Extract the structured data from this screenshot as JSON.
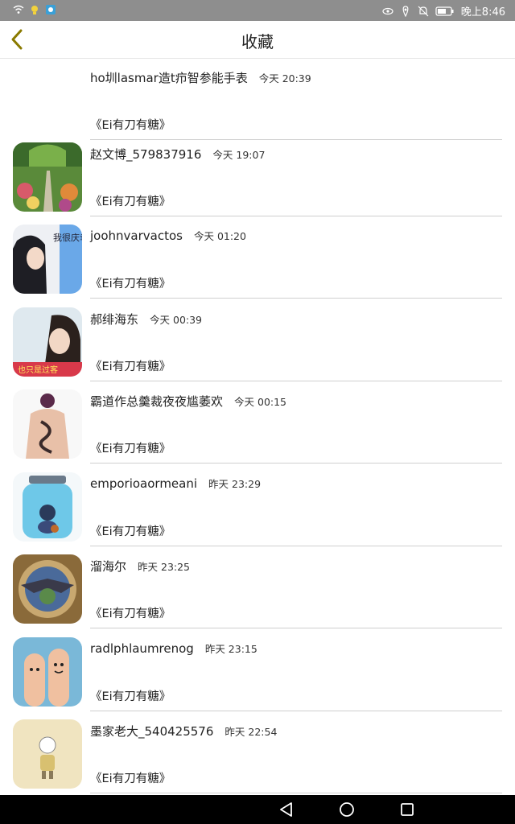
{
  "status_bar": {
    "time": "晚上8:46",
    "icons": [
      "wifi-icon",
      "bulb-icon",
      "app-icon",
      "eye-icon",
      "location-icon",
      "mute-icon",
      "battery-icon"
    ]
  },
  "header": {
    "title": "收藏",
    "back_icon": "chevron-left-icon"
  },
  "items": [
    {
      "name": "ho圳lasmar造t疖智参能手表",
      "time": "今天 20:39",
      "quote": "《Ei有刀有糖》",
      "avatar": "none"
    },
    {
      "name": "赵文博_579837916",
      "time": "今天 19:07",
      "quote": "《Ei有刀有糖》",
      "avatar": "garden"
    },
    {
      "name": "joohnvarvactos",
      "time": "今天 01:20",
      "quote": "《Ei有刀有糖》",
      "avatar": "girl-with-text",
      "avatar_text": "我很庆幸 我遇见你"
    },
    {
      "name": "郝绯海东",
      "time": "今天 00:39",
      "quote": "《Ei有刀有糖》",
      "avatar": "girl-sky",
      "avatar_text": "也只是过客"
    },
    {
      "name": "霸道作总羹裁夜夜尴萎欢",
      "time": "今天 00:15",
      "quote": "《Ei有刀有糖》",
      "avatar": "dragon-tattoo"
    },
    {
      "name": "emporioaormeani",
      "time": "昨天 23:29",
      "quote": "《Ei有刀有糖》",
      "avatar": "jar"
    },
    {
      "name": "溜海尔",
      "time": "昨天 23:25",
      "quote": "《Ei有刀有糖》",
      "avatar": "bat-emblem"
    },
    {
      "name": "radlphlaumrenog",
      "time": "昨天 23:15",
      "quote": "《Ei有刀有糖》",
      "avatar": "finger-faces"
    },
    {
      "name": "墨家老大_540425576",
      "time": "昨天 22:54",
      "quote": "《Ei有刀有糖》",
      "avatar": "skeleton"
    }
  ],
  "nav": {
    "back": "triangle-back-icon",
    "home": "circle-home-icon",
    "recents": "square-recents-icon"
  },
  "colors": {
    "accent": "#8a7a00",
    "statusbar": "#8e8e8e",
    "divider": "#cfcfcf"
  }
}
